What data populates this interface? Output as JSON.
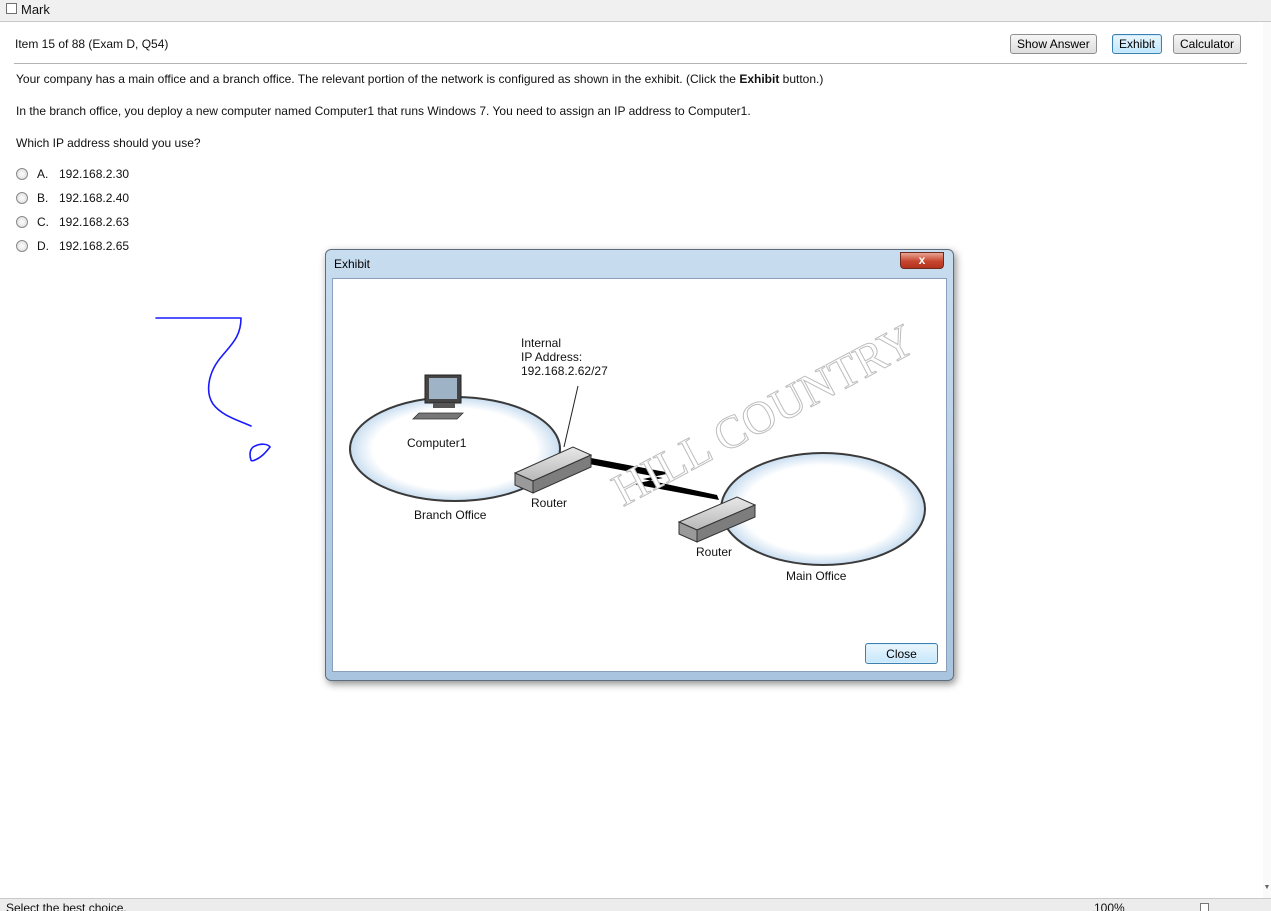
{
  "topbar": {
    "mark_label": "Mark"
  },
  "header": {
    "item_info": "Item 15 of 88  (Exam D, Q54)",
    "buttons": {
      "show_answer": "Show Answer",
      "exhibit": "Exhibit",
      "calculator": "Calculator"
    }
  },
  "question": {
    "p1_before": "Your company has a main office and a branch office. The relevant portion of the network is configured as shown in the exhibit. (Click the ",
    "p1_bold": "Exhibit",
    "p1_after": " button.)",
    "p2": "In the branch office, you deploy a new computer named Computer1 that runs Windows 7. You need to assign an IP address to Computer1.",
    "p3": "Which IP address should you use?",
    "options": [
      {
        "letter": "A.",
        "text": "192.168.2.30"
      },
      {
        "letter": "B.",
        "text": "192.168.2.40"
      },
      {
        "letter": "C.",
        "text": "192.168.2.63"
      },
      {
        "letter": "D.",
        "text": "192.168.2.65"
      }
    ]
  },
  "exhibit_dialog": {
    "title": "Exhibit",
    "close_x": "x",
    "close_button": "Close",
    "diagram": {
      "callout_line1": "Internal",
      "callout_line2": "IP Address:",
      "callout_line3": "192.168.2.62/27",
      "computer_label": "Computer1",
      "branch_router_label": "Router",
      "branch_office_label": "Branch Office",
      "main_router_label": "Router",
      "main_office_label": "Main Office",
      "watermark": "HILL COUNTRY"
    }
  },
  "statusbar": {
    "text": "Select the best choice.",
    "zoom": "100%"
  },
  "colors": {
    "accent_button": "#bee6fd",
    "close_red": "#c7462f",
    "ink": "#1a1aff"
  }
}
